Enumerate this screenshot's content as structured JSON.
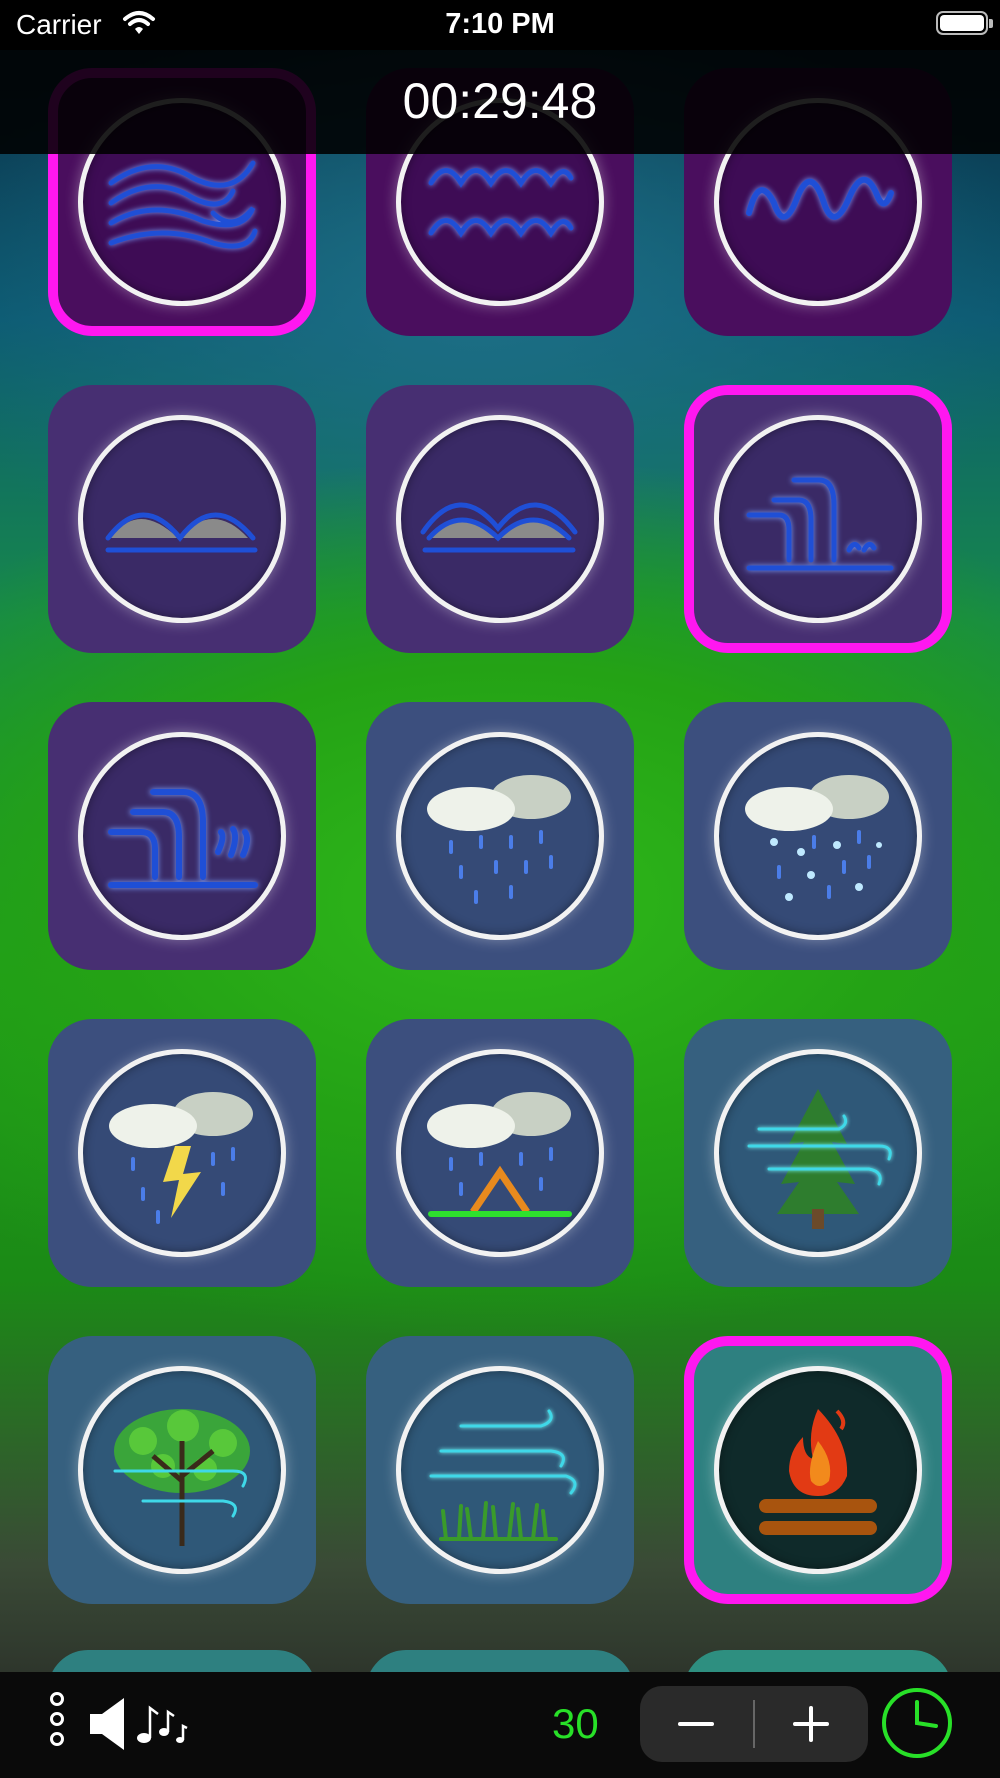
{
  "status_bar": {
    "carrier": "Carrier",
    "time": "7:10 PM"
  },
  "header": {
    "timer": "00:29:48"
  },
  "colors": {
    "selected_border": "#ff17f0",
    "count_text": "#28e028",
    "water_stroke": "#1f4fd6",
    "wind_stroke": "#3fd8e8"
  },
  "tiles": [
    {
      "name": "ocean-waves-wind",
      "icon": "wind-waves-icon",
      "selected": true
    },
    {
      "name": "ocean-waves",
      "icon": "waves-icon",
      "selected": false
    },
    {
      "name": "stream",
      "icon": "stream-icon",
      "selected": false
    },
    {
      "name": "brook-stones",
      "icon": "brook-stones-icon",
      "selected": false
    },
    {
      "name": "river-stones",
      "icon": "river-stones-icon",
      "selected": false
    },
    {
      "name": "waterfall",
      "icon": "waterfall-icon",
      "selected": true
    },
    {
      "name": "large-waterfall",
      "icon": "large-waterfall-icon",
      "selected": false
    },
    {
      "name": "rain",
      "icon": "rain-icon",
      "selected": false
    },
    {
      "name": "rain-and-snow",
      "icon": "sleet-icon",
      "selected": false
    },
    {
      "name": "thunderstorm",
      "icon": "thunderstorm-icon",
      "selected": false
    },
    {
      "name": "rain-on-tent",
      "icon": "tent-rain-icon",
      "selected": false
    },
    {
      "name": "wind-in-pines",
      "icon": "pine-wind-icon",
      "selected": false
    },
    {
      "name": "wind-in-trees",
      "icon": "tree-wind-icon",
      "selected": false
    },
    {
      "name": "wind-in-grass",
      "icon": "grass-wind-icon",
      "selected": false
    },
    {
      "name": "campfire",
      "icon": "campfire-icon",
      "selected": true
    }
  ],
  "bottom_bar": {
    "more_icon": "more-vertical-icon",
    "volume_icon": "speaker-icon",
    "music_icon": "music-notes-icon",
    "count": "30",
    "minus_label": "−",
    "plus_label": "+",
    "timer_icon": "clock-icon"
  }
}
